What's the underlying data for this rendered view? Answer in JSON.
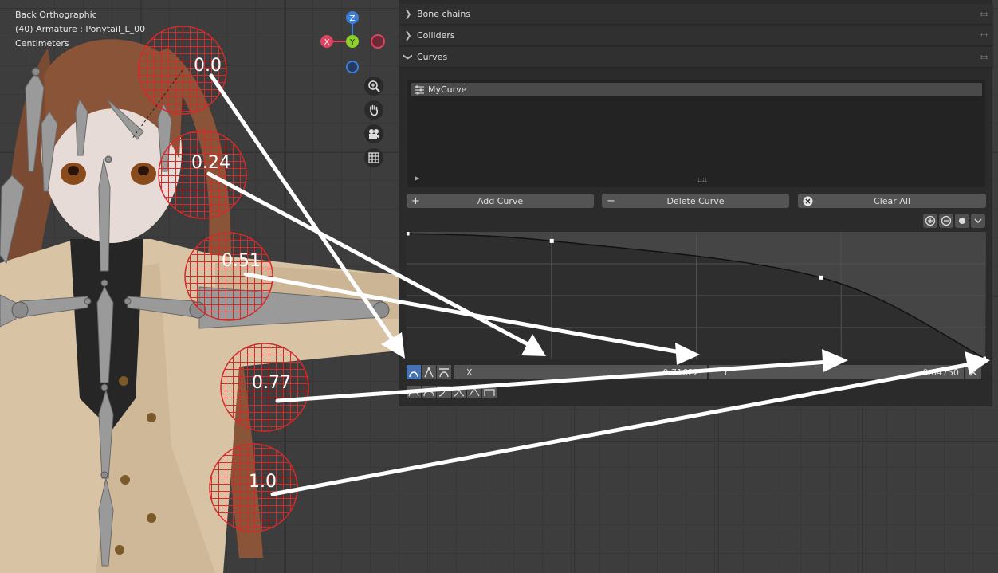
{
  "viewport": {
    "view_name": "Back Orthographic",
    "object_info": "(40) Armature : Ponytail_L_00",
    "units": "Centimeters",
    "gizmo": {
      "z": "Z",
      "y": "Y",
      "x": "X"
    },
    "nav_icons": [
      "zoom-icon",
      "hand-pan-icon",
      "camera-icon",
      "grid-icon"
    ]
  },
  "panel": {
    "sections": [
      {
        "label": "Bone chains",
        "state": "collapsed"
      },
      {
        "label": "Colliders",
        "state": "collapsed"
      },
      {
        "label": "Curves",
        "state": "expanded"
      }
    ],
    "curve_list": {
      "items": [
        "MyCurve"
      ]
    },
    "buttons": {
      "add": "Add Curve",
      "delete": "Delete Curve",
      "clear": "Clear All"
    },
    "curve_editor": {
      "points": [
        [
          0,
          1.0
        ],
        [
          0.25,
          0.94
        ],
        [
          0.71622,
          0.6475
        ],
        [
          1.0,
          0.0
        ]
      ],
      "x_label": "X",
      "x_value": "0.71622",
      "y_label": "Y",
      "y_value": "0.64750"
    }
  },
  "annotations": {
    "labels": [
      "0.0",
      "0.24",
      "0.51",
      "0.77",
      "1.0"
    ]
  },
  "colors": {
    "accent": "#4772b3",
    "collider": "#d42a2a",
    "gizmo_x": "#e0435f",
    "gizmo_y": "#8bd12a",
    "gizmo_z": "#3c7fd6"
  }
}
